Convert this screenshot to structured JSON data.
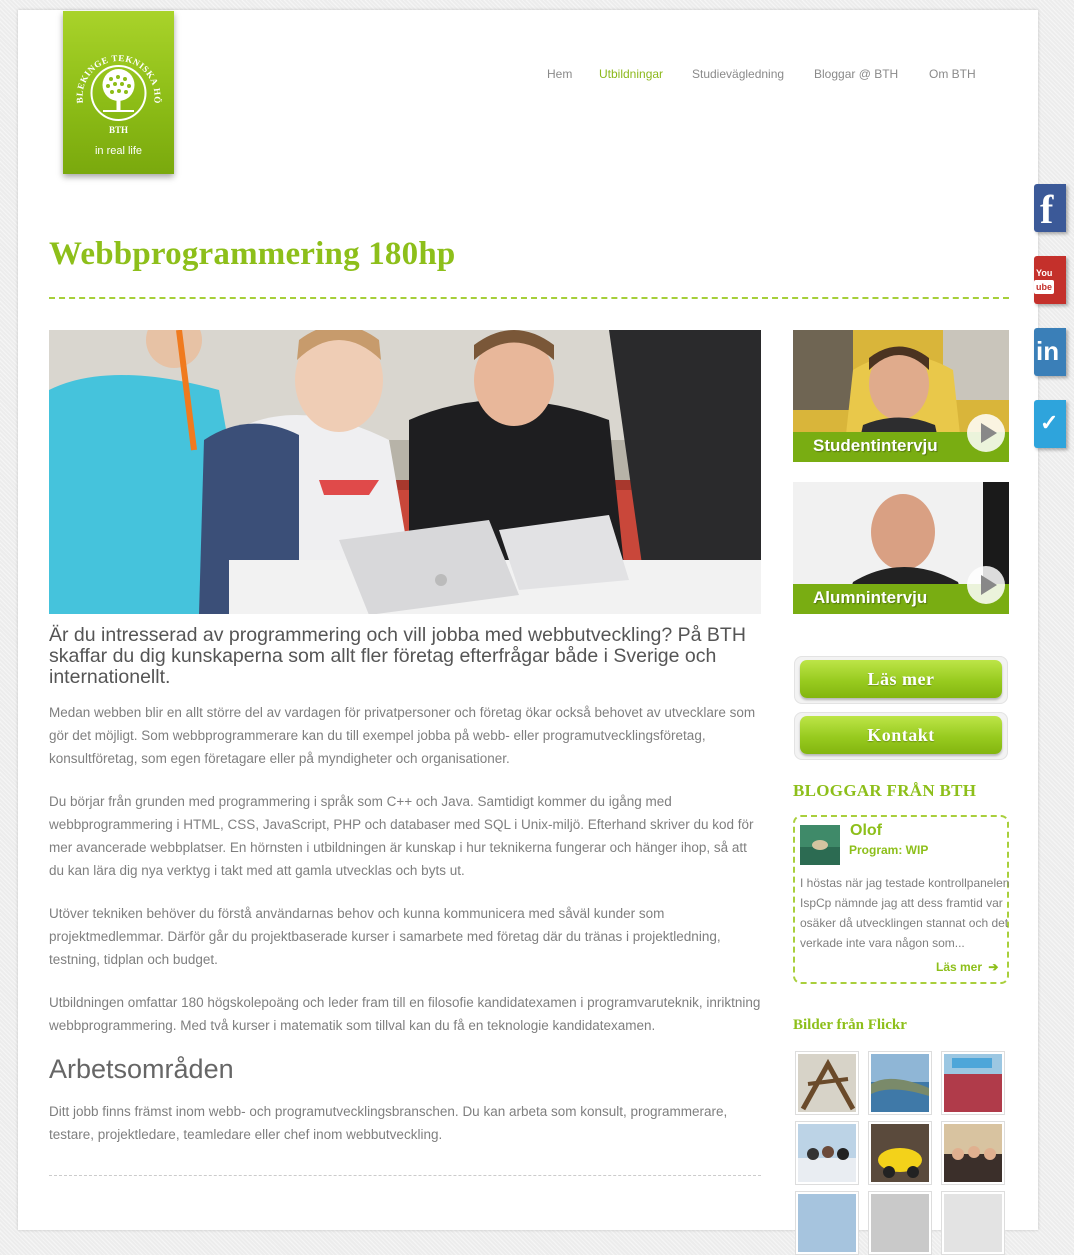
{
  "logo": {
    "ring_text": "BLEKINGE TEKNISKA HÖGSKOLA",
    "abbr": "BTH",
    "tagline": "in real life"
  },
  "nav": {
    "items": [
      {
        "label": "Hem",
        "active": false
      },
      {
        "label": "Utbildningar",
        "active": true
      },
      {
        "label": "Studievägledning",
        "active": false
      },
      {
        "label": "Bloggar @ BTH",
        "active": false
      },
      {
        "label": "Om BTH",
        "active": false
      }
    ]
  },
  "social": [
    {
      "name": "facebook",
      "glyph": "f",
      "color": "#3b5998"
    },
    {
      "name": "youtube",
      "glyph": "ube",
      "color": "#c4302b"
    },
    {
      "name": "linkedin",
      "glyph": "in",
      "color": "#3a7fb8"
    },
    {
      "name": "twitter",
      "glyph": "✓",
      "color": "#2ea4dc"
    }
  ],
  "main": {
    "title": "Webbprogrammering 180hp",
    "lead": "Är du intresserad av programmering och vill jobba med webbutveckling? På BTH skaffar du dig kunskaperna som allt fler företag efterfrågar både i Sverige och internationellt.",
    "paragraphs": [
      "Medan webben blir en allt större del av vardagen för privatpersoner och företag ökar också behovet av utvecklare som gör det möjligt. Som webbprogrammerare kan du till exempel jobba på webb- eller programutvecklingsföretag, konsultföretag, som egen företagare eller på myndigheter och organisationer.",
      "Du börjar från grunden med programmering i språk som C++ och Java. Samtidigt kommer du igång med webbprogrammering i HTML, CSS, JavaScript, PHP och databaser med SQL i Unix-miljö. Efterhand skriver du kod för mer avancerade webbplatser. En hörnsten i utbildningen är kunskap i hur teknikerna fungerar och hänger ihop, så att du kan lära dig nya verktyg i takt med att gamla utvecklas och byts ut.",
      "Utöver tekniken behöver du förstå användarnas behov och kunna kommunicera med såväl kunder som projektmedlemmar. Därför går du projektbaserade kurser i samarbete med företag där du tränas i projektledning, testning, tidplan och budget.",
      "Utbildningen omfattar 180 högskolepoäng och leder fram till en filosofie kandidatexamen i programvaruteknik, inriktning webbprogrammering. Med två kurser i matematik som tillval kan du få en teknologie kandidatexamen."
    ],
    "section_heading": "Arbetsområden",
    "section_text": "Ditt jobb finns främst inom webb- och programutvecklingsbranschen. Du kan arbeta som konsult, programmerare, testare, projektledare, teamledare eller chef inom webbutveckling."
  },
  "sidebar": {
    "videos": [
      {
        "label": "Studentintervju"
      },
      {
        "label": "Alumnintervju"
      }
    ],
    "buttons": {
      "read_more": "Läs mer",
      "contact": "Kontakt"
    },
    "blogs_heading": "BLOGGAR FRÅN BTH",
    "blog": {
      "author": "Olof",
      "program": "Program: WIP",
      "excerpt": "I höstas när jag testade kontrollpanelen IspCp nämnde jag att dess framtid var osäker då utvecklingen stannat och det verkade inte vara någon som...",
      "more": "Läs mer"
    },
    "flickr_heading": "Bilder från Flickr"
  }
}
